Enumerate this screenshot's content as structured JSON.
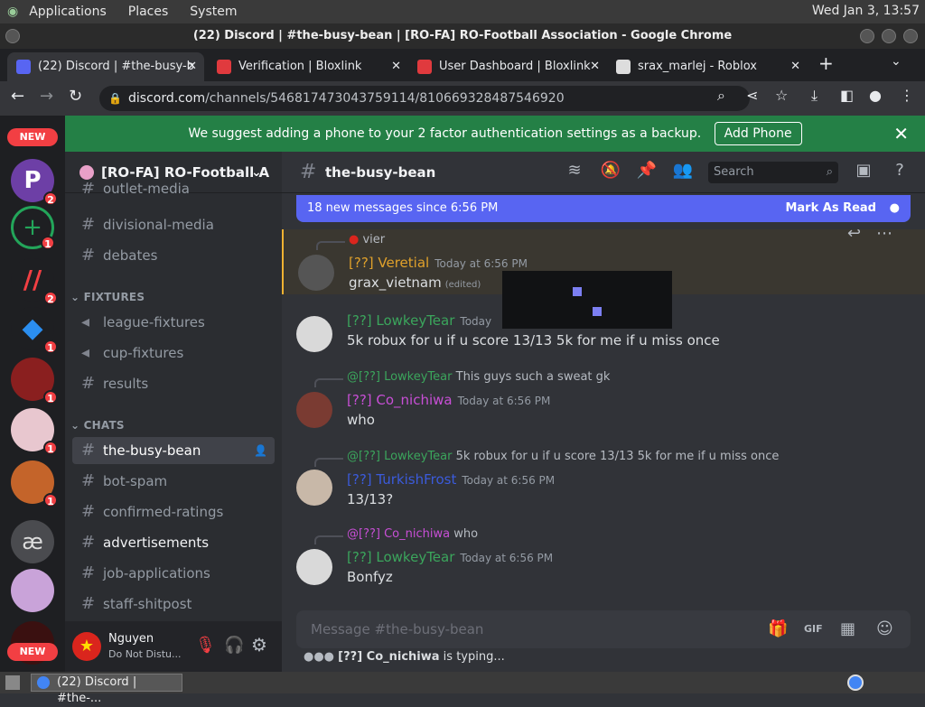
{
  "os": {
    "menu": [
      "Applications",
      "Places",
      "System"
    ],
    "clock": "Wed Jan  3, 13:57"
  },
  "window": {
    "title": "(22) Discord | #the-busy-bean | [RO-FA] RO-Football Association - Google Chrome"
  },
  "tabs": [
    {
      "label": "(22) Discord | #the-busy-b",
      "active": true
    },
    {
      "label": "Verification | Bloxlink"
    },
    {
      "label": "User Dashboard | Bloxlink"
    },
    {
      "label": "srax_marlej - Roblox"
    }
  ],
  "address": {
    "domain": "discord.com",
    "path": "/channels/546817473043759114/810669328487546920"
  },
  "rail": {
    "new_top": "NEW",
    "new_bottom": "NEW",
    "badges": [
      "2",
      "1",
      "2",
      "1",
      "1",
      "1",
      "1"
    ]
  },
  "banner": {
    "text": "We suggest adding a phone to your 2 factor authentication settings as a backup.",
    "button": "Add Phone"
  },
  "server": {
    "name": "[RO-FA] RO-Football A"
  },
  "channels": {
    "top": [
      "outlet-media",
      "divisional-media",
      "debates"
    ],
    "cat_fixtures": "FIXTURES",
    "fixtures": [
      "league-fixtures",
      "cup-fixtures",
      "results"
    ],
    "cat_chats": "CHATS",
    "chats": [
      "the-busy-bean",
      "bot-spam",
      "confirmed-ratings",
      "advertisements",
      "job-applications",
      "staff-shitpost"
    ]
  },
  "user": {
    "name": "Nguyen",
    "status": "Do Not Distu..."
  },
  "header": {
    "channel": "the-busy-bean",
    "search": "Search"
  },
  "newbar": {
    "text": "18 new messages since 6:56 PM",
    "mark": "Mark As Read"
  },
  "messages": [
    {
      "reply_author": "",
      "reply_text": "vier",
      "author": "[??] Veretial",
      "time": "Today at 6:56 PM",
      "body": "grax_vietnam",
      "edited": "(edited)",
      "color": "#e0a12b"
    },
    {
      "author": "[??] LowkeyTear",
      "time": "Today",
      "body": "5k robux for u if u score 13/13 5k for me if u miss once",
      "color": "#3ba55c"
    },
    {
      "reply_author": "@[??] LowkeyTear",
      "reply_text": "This guys such a sweat gk",
      "author": "[??] Co_nichiwa",
      "time": "Today at 6:56 PM",
      "body": "who",
      "color": "#c84fd6"
    },
    {
      "reply_author": "@[??] LowkeyTear",
      "reply_text": "5k robux for u if u score 13/13 5k for me if u miss once",
      "author": "[??] TurkishFrost",
      "time": "Today at 6:56 PM",
      "body": "13/13?",
      "color": "#3b5bdb"
    },
    {
      "reply_author": "@[??] Co_nichiwa",
      "reply_text": "who",
      "author": "[??] LowkeyTear",
      "time": "Today at 6:56 PM",
      "body": "Bonfyz",
      "color": "#3ba55c"
    }
  ],
  "composer": {
    "placeholder": "Message #the-busy-bean"
  },
  "typing": {
    "name": "[??] Co_nichiwa",
    "suffix": " is typing..."
  },
  "taskbar": {
    "item": "(22) Discord | #the-..."
  }
}
